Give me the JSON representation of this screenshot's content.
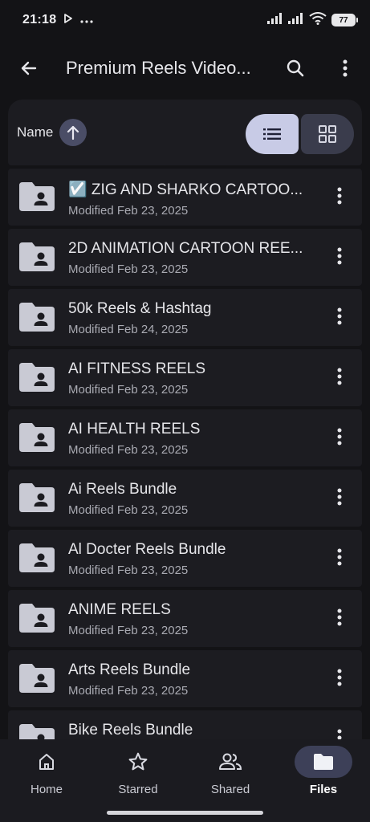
{
  "status_bar": {
    "time": "21:18",
    "battery": "77"
  },
  "app_bar": {
    "title": "Premium Reels Video..."
  },
  "sort_header": {
    "label": "Name"
  },
  "files": [
    {
      "name": "☑️ ZIG AND SHARKO CARTOO...",
      "modified": "Modified Feb 23, 2025"
    },
    {
      "name": "2D ANIMATION CARTOON REE...",
      "modified": "Modified Feb 23, 2025"
    },
    {
      "name": "50k Reels & Hashtag",
      "modified": "Modified Feb 24, 2025"
    },
    {
      "name": "AI FITNESS REELS",
      "modified": "Modified Feb 23, 2025"
    },
    {
      "name": "AI HEALTH REELS",
      "modified": "Modified Feb 23, 2025"
    },
    {
      "name": "Ai Reels Bundle",
      "modified": "Modified Feb 23, 2025"
    },
    {
      "name": "Al Docter Reels Bundle",
      "modified": "Modified Feb 23, 2025"
    },
    {
      "name": "ANIME REELS",
      "modified": "Modified Feb 23, 2025"
    },
    {
      "name": "Arts Reels Bundle",
      "modified": "Modified Feb 23, 2025"
    },
    {
      "name": "Bike Reels Bundle",
      "modified": ""
    }
  ],
  "bottom_nav": {
    "home": "Home",
    "starred": "Starred",
    "shared": "Shared",
    "files": "Files"
  },
  "icons": {
    "back": "arrow-back-icon",
    "search": "search-icon",
    "more": "more-vert-icon",
    "folder": "shared-folder-icon",
    "list_view": "list-view-icon",
    "grid_view": "grid-view-icon"
  },
  "colors": {
    "background": "#131316",
    "surface": "#1c1c21",
    "accent": "#c8cbe6",
    "active_nav": "#3d4058"
  }
}
